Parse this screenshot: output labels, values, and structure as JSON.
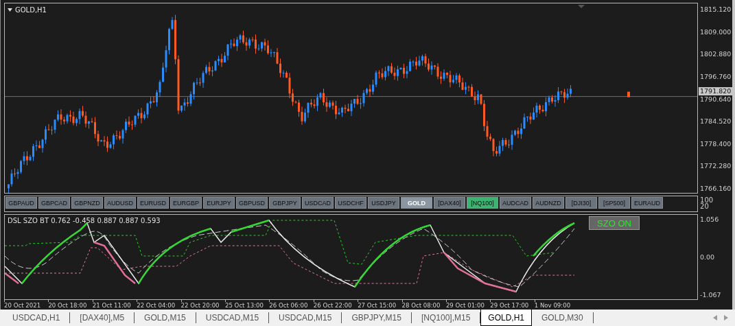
{
  "chart": {
    "title": "GOLD,H1",
    "price_labels": [
      "1815.120",
      "1809.000",
      "1802.880",
      "1796.760",
      "1790.640",
      "1784.520",
      "1778.400",
      "1772.280",
      "1766.160"
    ],
    "current_price": "1791.820"
  },
  "symbol_buttons": [
    {
      "label": "GBPAUD",
      "selected": false,
      "on": false
    },
    {
      "label": "GBPCAD",
      "selected": false,
      "on": false
    },
    {
      "label": "GBPNZD",
      "selected": false,
      "on": false
    },
    {
      "label": "AUDUSD",
      "selected": false,
      "on": false
    },
    {
      "label": "EURUSD",
      "selected": false,
      "on": false
    },
    {
      "label": "EURGBP",
      "selected": false,
      "on": false
    },
    {
      "label": "EURJPY",
      "selected": false,
      "on": false
    },
    {
      "label": "GBPUSD",
      "selected": false,
      "on": false
    },
    {
      "label": "GBPJPY",
      "selected": false,
      "on": false
    },
    {
      "label": "USDCAD",
      "selected": false,
      "on": false
    },
    {
      "label": "USDCHF",
      "selected": false,
      "on": false
    },
    {
      "label": "USDJPY",
      "selected": false,
      "on": false
    },
    {
      "label": "GOLD",
      "selected": true,
      "on": false
    },
    {
      "label": "[DAX40]",
      "selected": false,
      "on": false
    },
    {
      "label": "[NQ100]",
      "selected": false,
      "on": true
    },
    {
      "label": "AUDCAD",
      "selected": false,
      "on": false
    },
    {
      "label": "AUDNZD",
      "selected": false,
      "on": false
    },
    {
      "label": "[DJI30]",
      "selected": false,
      "on": false
    },
    {
      "label": "[SP500]",
      "selected": false,
      "on": false
    },
    {
      "label": "EURAUD",
      "selected": false,
      "on": false
    }
  ],
  "button_axis_labels": [
    "100",
    "20"
  ],
  "indicator": {
    "label": "DSL SZO BT 0.762 -0.458 0.887 0.887 0.593",
    "toggle": "SZO ON",
    "axis_labels": [
      "1.056",
      "0.00",
      "-1.067"
    ]
  },
  "time_labels": [
    "20 Oct 2021",
    "20 Oct 18:00",
    "21 Oct 11:00",
    "22 Oct 04:00",
    "22 Oct 20:00",
    "25 Oct 13:00",
    "26 Oct 06:00",
    "26 Oct 22:00",
    "27 Oct 15:00",
    "28 Oct 08:00",
    "29 Oct 01:00",
    "29 Oct 17:00",
    "1 Nov 09:00"
  ],
  "tabs": [
    {
      "label": "USDCAD,H1",
      "selected": false
    },
    {
      "label": "[DAX40],M5",
      "selected": false
    },
    {
      "label": "GOLD,M15",
      "selected": false
    },
    {
      "label": "USDCAD,M15",
      "selected": false
    },
    {
      "label": "USDCAD,M15",
      "selected": false
    },
    {
      "label": "GBPJPY,M15",
      "selected": false
    },
    {
      "label": "[NQ100],M15",
      "selected": false
    },
    {
      "label": "GOLD,H1",
      "selected": true
    },
    {
      "label": "GOLD,M30",
      "selected": false
    }
  ]
}
